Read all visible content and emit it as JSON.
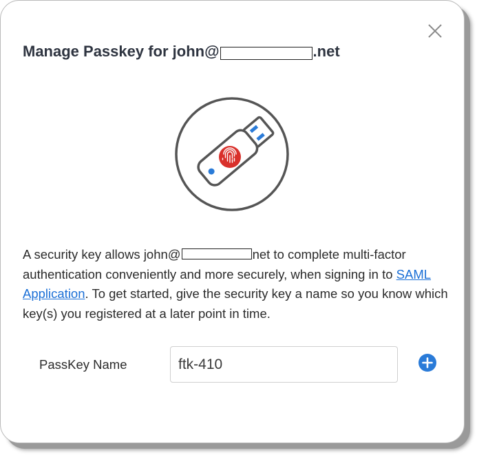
{
  "dialog": {
    "title_prefix": "Manage Passkey for john@",
    "title_suffix": ".net",
    "close_icon": "close-icon",
    "illustration_icon": "usb-security-key-fingerprint-icon",
    "description": {
      "part1": "A security key allows john@",
      "part2": "net to complete multi-factor authentication conveniently and more securely, when signing in to ",
      "link_text": "SAML Application",
      "part3": ". To get started, give the security key a name so you know which key(s) you registered at a later point in time."
    },
    "field": {
      "label": "PassKey Name",
      "value": "ftk-410"
    },
    "add_icon": "plus-circle-icon"
  },
  "colors": {
    "title_text": "#2e3440",
    "link": "#1a6fd6",
    "fingerprint_red": "#d9302b",
    "accent_blue": "#2a7bd8",
    "icon_gray": "#555555"
  }
}
